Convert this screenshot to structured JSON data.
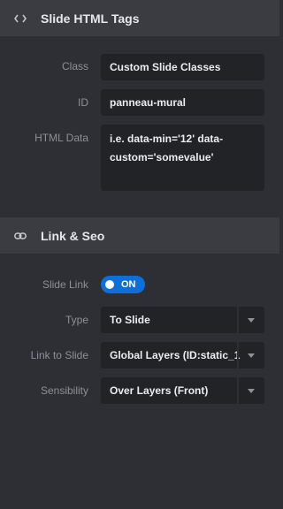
{
  "html_tags": {
    "title": "Slide HTML Tags",
    "icon": "code-icon",
    "class_label": "Class",
    "class_value": "Custom Slide Classes",
    "id_label": "ID",
    "id_value": "panneau-mural",
    "data_label": "HTML Data",
    "data_line1": "i.e. data-min='12' data-",
    "data_line2": "custom='somevalue'"
  },
  "link_seo": {
    "title": "Link & Seo",
    "icon": "link-icon",
    "slide_link_label": "Slide Link",
    "slide_link_state": "ON",
    "type_label": "Type",
    "type_value": "To Slide",
    "link_to_label": "Link to Slide",
    "link_to_value": "Global Layers (ID:static_1",
    "sensibility_label": "Sensibility",
    "sensibility_value": "Over Layers (Front)"
  },
  "colors": {
    "background": "#2e2f34",
    "header": "#3a3c42",
    "field": "#222327",
    "accent": "#0f6fd9"
  }
}
